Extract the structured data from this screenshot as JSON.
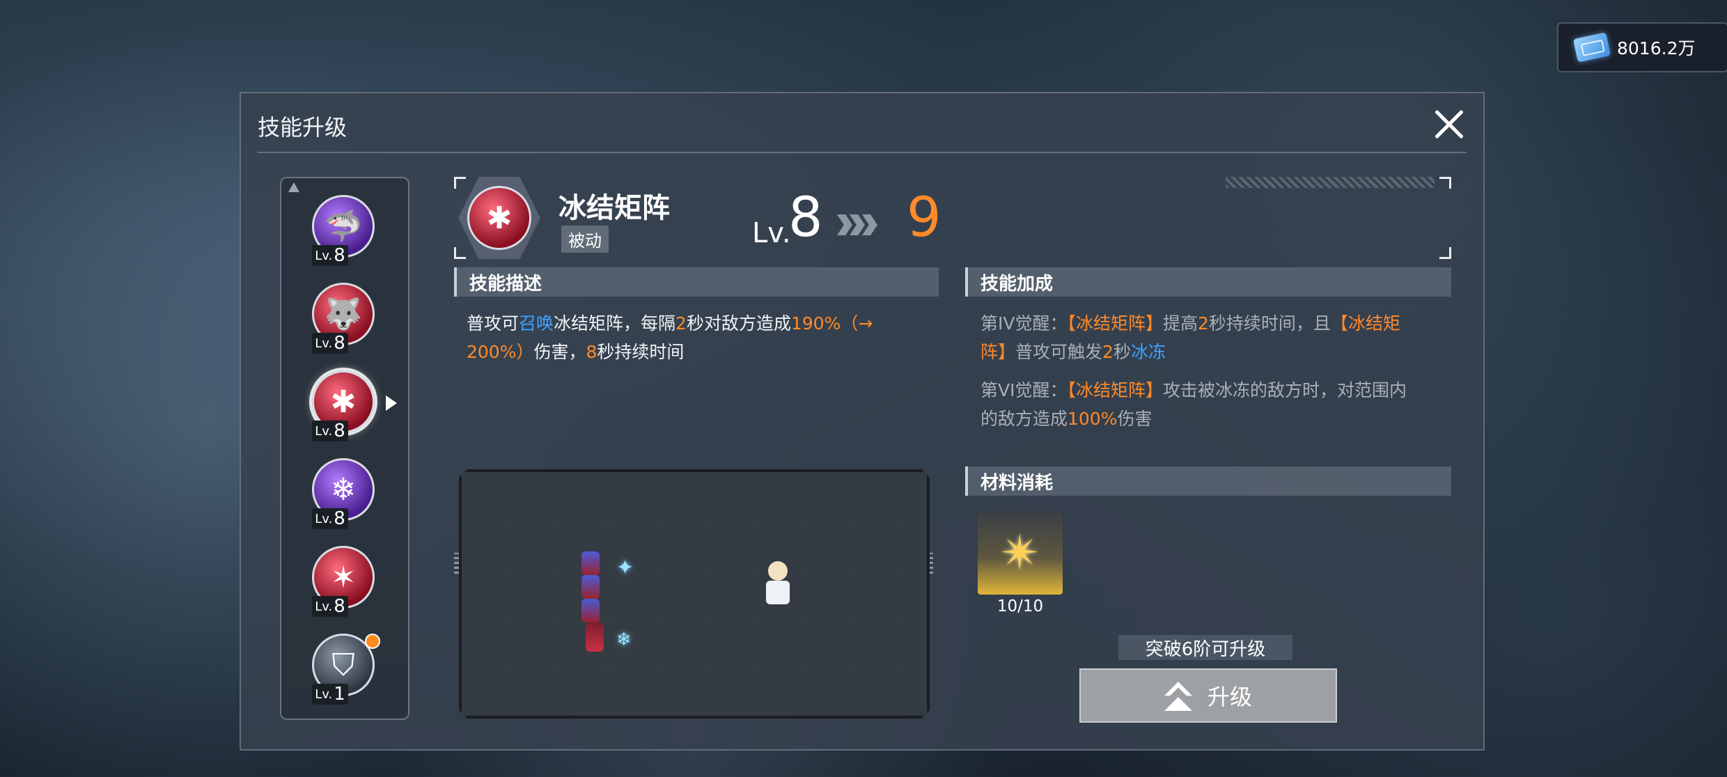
{
  "currency": {
    "icon": "ticket-icon",
    "value": "8016.2万"
  },
  "panel": {
    "title": "技能升级"
  },
  "side_list": [
    {
      "name": "shark-skill",
      "level": "8",
      "color": "#6b3fd0"
    },
    {
      "name": "wolf-skill",
      "level": "8",
      "color": "#c8283e"
    },
    {
      "name": "ice-flower-skill",
      "level": "8",
      "color": "#c8283e",
      "selected": true
    },
    {
      "name": "snowflake-skill",
      "level": "8",
      "color": "#6b3fd0"
    },
    {
      "name": "red-burst-skill",
      "level": "8",
      "color": "#c8283e"
    },
    {
      "name": "shield-emblem-skill",
      "level": "1",
      "color": "#6a7684",
      "notification": true
    }
  ],
  "skill": {
    "name": "冰结矩阵",
    "tag": "被动",
    "level_label": "Lv.",
    "level_current": "8",
    "level_next": "9"
  },
  "description": {
    "header": "技能描述",
    "t1": "普攻可",
    "t2": "召唤",
    "t3": "冰结矩阵，每隔",
    "t4": "2",
    "t5": "秒对敌方造成",
    "t6": "190%（→",
    "t7": "200%）",
    "t8": "伤害，",
    "t9": "8",
    "t10": "秒持续时间"
  },
  "bonus": {
    "header": "技能加成",
    "a1": "第IV觉醒：",
    "a2": "【冰结矩阵】",
    "a3": "提高",
    "a4": "2",
    "a5": "秒持续时间，且",
    "a6": "【冰结矩",
    "a7": "阵】",
    "a8": "普攻可触发",
    "a9": "2",
    "a10": "秒",
    "a11": "冰冻",
    "b1": "第VI觉醒：",
    "b2": "【冰结矩阵】",
    "b3": "攻击被冰冻的敌方时，对范围内",
    "b4": "的敌方造成",
    "b5": "100%",
    "b6": "伤害"
  },
  "materials": {
    "header": "材料消耗",
    "item_icon": "star-crystal-icon",
    "count": "10/10"
  },
  "upgrade": {
    "requirement": "突破6阶可升级",
    "button_label": "升级"
  },
  "colors": {
    "highlight_orange": "#ff8a2a",
    "highlight_blue": "#3ea3ff"
  }
}
